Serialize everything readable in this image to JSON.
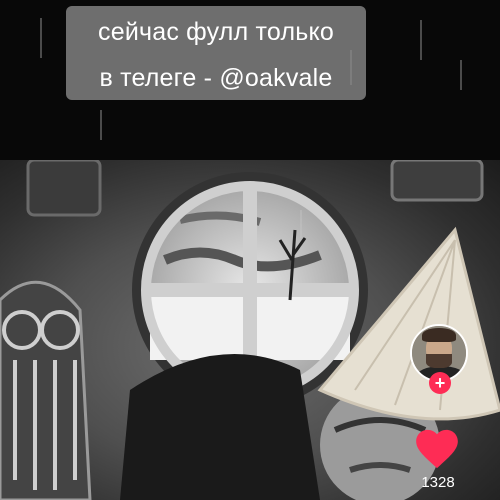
{
  "overlay": {
    "caption_line_1": "сейчас фулл только",
    "caption_line_2": "в телеге - @oakvale"
  },
  "actions": {
    "like_count": "1328",
    "like_color": "#fe2c55",
    "follow_glyph": "+",
    "follow_color": "#fe2c55"
  },
  "icons": {
    "like": "heart-icon",
    "follow": "plus-icon"
  }
}
